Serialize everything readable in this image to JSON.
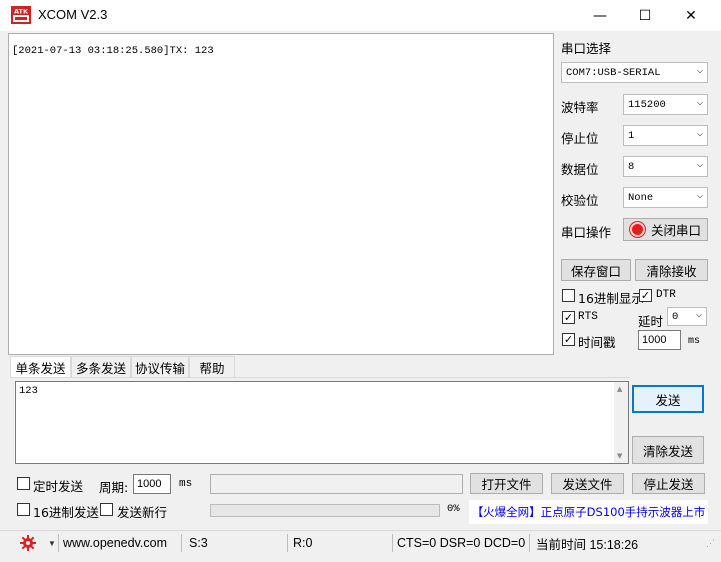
{
  "window": {
    "title": "XCOM V2.3",
    "logo_text": "ATK",
    "minimize_glyph": "—",
    "maximize_glyph": "☐",
    "close_glyph": "✕"
  },
  "receive": {
    "text": "[2021-07-13 03:18:25.580]TX: 123"
  },
  "port_panel": {
    "port_select_label": "串口选择",
    "port_value": "COM7:USB-SERIAL",
    "baud_label": "波特率",
    "baud_value": "115200",
    "stop_label": "停止位",
    "stop_value": "1",
    "data_label": "数据位",
    "data_value": "8",
    "parity_label": "校验位",
    "parity_value": "None",
    "op_label": "串口操作",
    "close_port_button": "关闭串口",
    "save_window_button": "保存窗口",
    "clear_recv_button": "清除接收",
    "hex_display_label": "16进制显示",
    "hex_display_checked": false,
    "dtr_label": "DTR",
    "dtr_checked": true,
    "rts_label": "RTS",
    "rts_checked": true,
    "delay_label": "延时",
    "delay_value": "0",
    "timestamp_label": "时间戳",
    "timestamp_checked": true,
    "timestamp_value": "1000",
    "timestamp_unit": "ms"
  },
  "tabs": [
    {
      "label": "单条发送",
      "active": true
    },
    {
      "label": "多条发送",
      "active": false
    },
    {
      "label": "协议传输",
      "active": false
    },
    {
      "label": "帮助",
      "active": false
    }
  ],
  "send": {
    "text": "123",
    "send_button": "发送",
    "clear_send_button": "清除发送",
    "timed_send_label": "定时发送",
    "timed_send_checked": false,
    "period_label": "周期:",
    "period_value": "1000",
    "period_unit": "ms",
    "open_file_button": "打开文件",
    "send_file_button": "发送文件",
    "stop_send_button": "停止发送",
    "hex_send_label": "16进制发送",
    "hex_send_checked": false,
    "newline_label": "发送新行",
    "newline_checked": false,
    "progress_text": "0%",
    "progress_fraction": 0,
    "ad_text": "【火爆全网】正点原子DS100手持示波器上市"
  },
  "statusbar": {
    "website": "www.openedv.com",
    "sent": "S:3",
    "received": "R:0",
    "signals": "CTS=0 DSR=0 DCD=0",
    "time": "当前时间 15:18:26"
  },
  "colors": {
    "accent_red": "#e02020",
    "ad_blue": "#0000ff",
    "focus_blue": "#0078d7"
  }
}
